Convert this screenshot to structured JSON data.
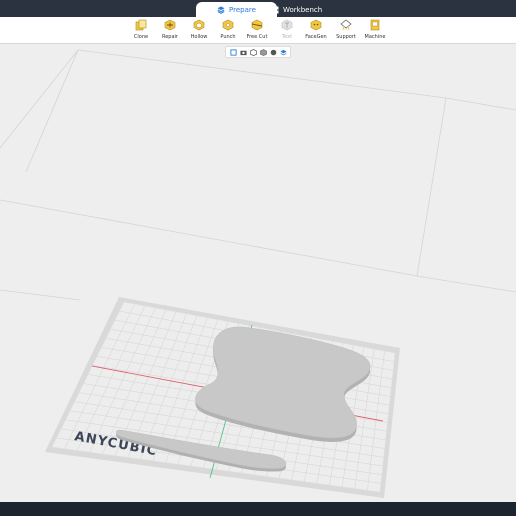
{
  "tabs": [
    {
      "label": "Prepare",
      "icon": "layers-icon",
      "active": true
    },
    {
      "label": "Workbench",
      "icon": "grid-icon",
      "active": false
    }
  ],
  "toolbar": [
    {
      "label": "Clone",
      "icon": "clone-icon",
      "enabled": true
    },
    {
      "label": "Repair",
      "icon": "repair-icon",
      "enabled": true
    },
    {
      "label": "Hollow",
      "icon": "hollow-icon",
      "enabled": true
    },
    {
      "label": "Punch",
      "icon": "punch-icon",
      "enabled": true
    },
    {
      "label": "Free Cut",
      "icon": "free-cut-icon",
      "enabled": true
    },
    {
      "label": "Text",
      "icon": "text-icon",
      "enabled": false
    },
    {
      "label": "FaceGen",
      "icon": "facegen-icon",
      "enabled": true
    },
    {
      "label": "Support",
      "icon": "support-icon",
      "enabled": true
    },
    {
      "label": "Machine",
      "icon": "machine-icon",
      "enabled": true
    }
  ],
  "view_buttons": [
    "view-cube-icon",
    "camera-icon",
    "view-front-icon",
    "view-side-icon",
    "sphere-icon",
    "layers-view-icon"
  ],
  "build_plate": {
    "brand": "ANYCUBIC",
    "axis_x_color": "#e05060",
    "axis_y_color": "#40c080"
  },
  "colors": {
    "accent": "#2a7bd6",
    "tab_bar": "#2c3340",
    "tool_icon": "#f2c744",
    "model": "#c8c8c8"
  }
}
